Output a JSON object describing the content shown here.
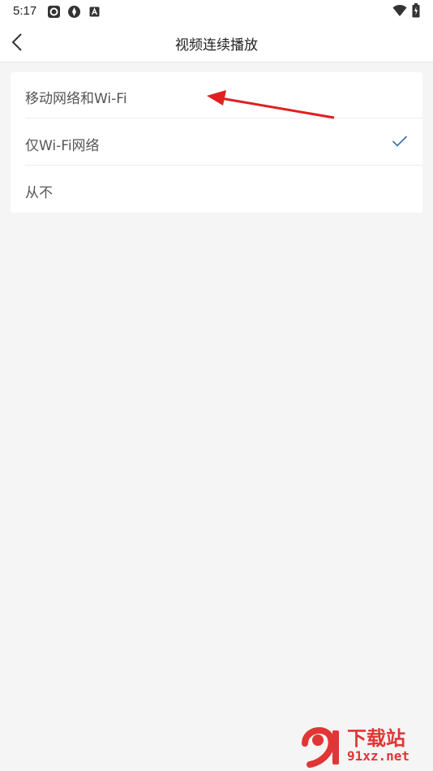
{
  "status_bar": {
    "time": "5:17",
    "icons": [
      "sim-app-icon",
      "aperture-icon",
      "a-box-icon",
      "wifi-icon",
      "battery-icon"
    ]
  },
  "header": {
    "back_icon": "chevron-left-icon",
    "title": "视频连续播放"
  },
  "options": [
    {
      "label": "移动网络和Wi-Fi",
      "selected": false
    },
    {
      "label": "仅Wi-Fi网络",
      "selected": true
    },
    {
      "label": "从不",
      "selected": false
    }
  ],
  "annotation": {
    "arrow_color": "#e02020"
  },
  "watermark": {
    "brand_text": "下载站",
    "site_text": "91xz.net",
    "color": "#e03636"
  },
  "colors": {
    "background": "#f5f5f5",
    "card": "#ffffff",
    "check": "#3a6ea5"
  }
}
